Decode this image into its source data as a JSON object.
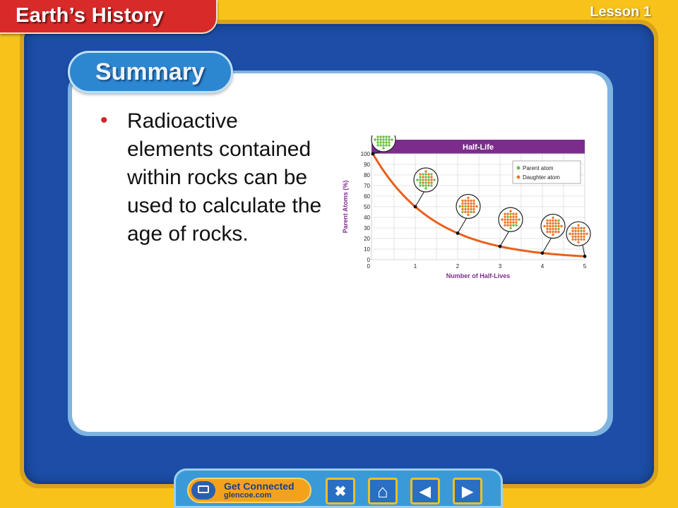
{
  "header": {
    "topic_title": "Earth’s History",
    "lesson_label": "Lesson 1"
  },
  "summary": {
    "tab_label": "Summary",
    "bullet_text": "Radioactive elements contained within rocks can be used to calculate the age of rocks."
  },
  "chart_data": {
    "type": "line",
    "title": "Half-Life",
    "xlabel": "Number of Half-Lives",
    "ylabel": "Parent Atoms (%)",
    "x": [
      0,
      1,
      2,
      3,
      4,
      5
    ],
    "series": [
      {
        "values": [
          100,
          50,
          25,
          12.5,
          6.25,
          3.125
        ]
      }
    ],
    "xticks": [
      "1",
      "2",
      "3",
      "4",
      "5"
    ],
    "yticks": [
      "0",
      "10",
      "20",
      "30",
      "40",
      "50",
      "60",
      "70",
      "80",
      "90",
      "100"
    ],
    "xlim": [
      0,
      5
    ],
    "ylim": [
      0,
      100
    ],
    "grid": true,
    "legend_position": "top-right",
    "legend": [
      {
        "label": "Parent atom",
        "color": "#6fbf45"
      },
      {
        "label": "Daughter atom",
        "color": "#ef7a2a"
      }
    ],
    "colors": {
      "curve": "#e8601c",
      "title_bar": "#7b2d8c",
      "axis_text": "#7b2d8c"
    }
  },
  "nav": {
    "get_connected_line1": "Get Connected",
    "get_connected_line2": "glencoe.com",
    "close_symbol": "✖",
    "home_symbol": "⌂",
    "prev_symbol": "◀",
    "next_symbol": "▶"
  },
  "colors": {
    "background_yellow": "#f7c21a",
    "frame_blue": "#1c4ea8",
    "topic_red": "#d92a2a",
    "summary_blue": "#2d86d0",
    "bullet_red": "#d32626"
  }
}
